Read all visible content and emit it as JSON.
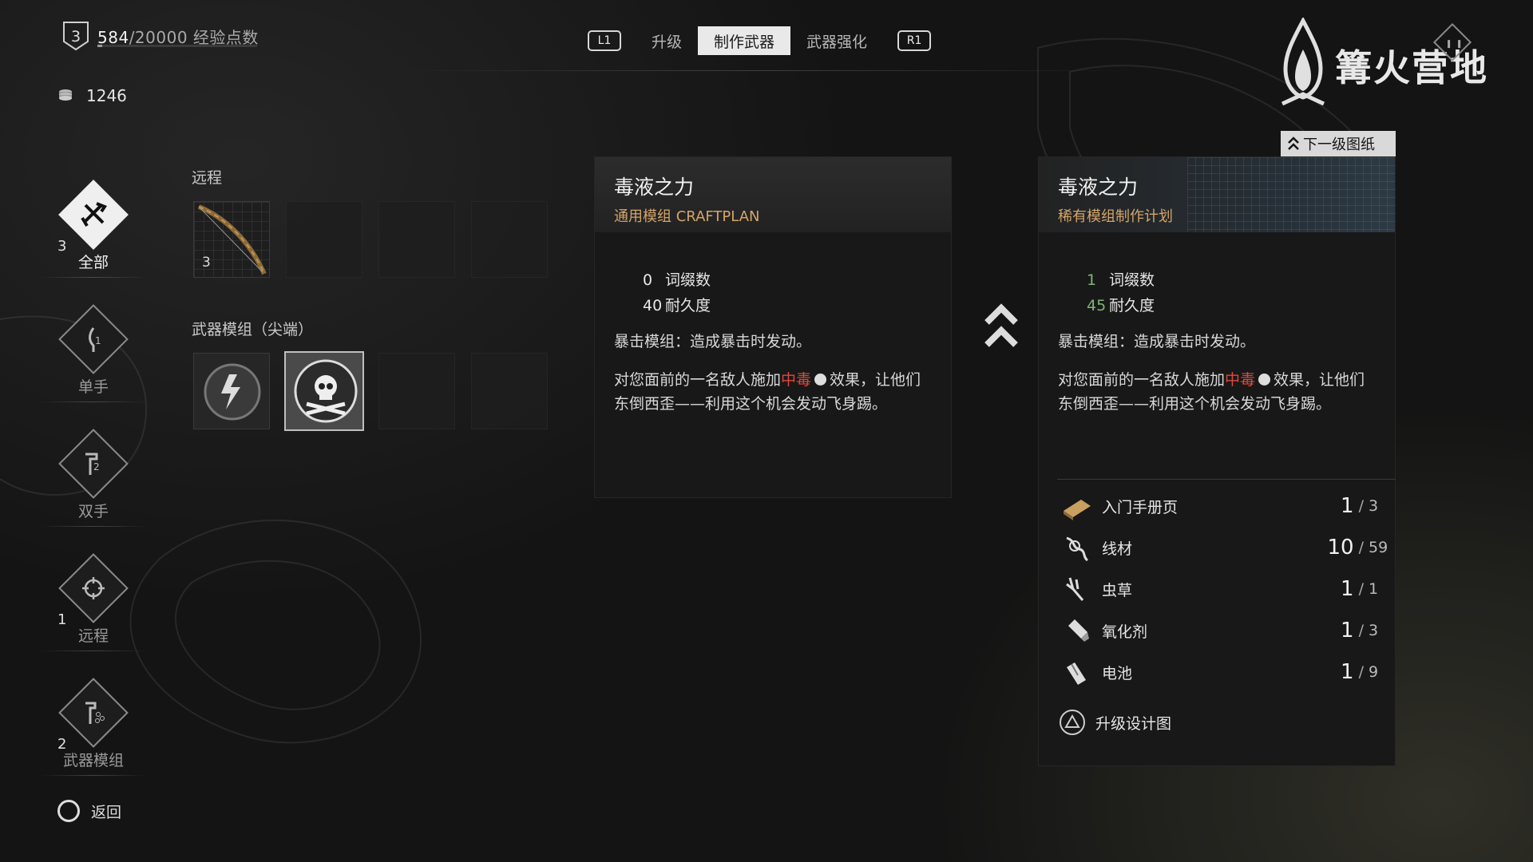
{
  "header": {
    "level": "3",
    "xp_current": "584",
    "xp_max": "/20000",
    "xp_label": "经验点数",
    "xp_progress": 0.029,
    "coins": "1246"
  },
  "tabs": {
    "left_hint": "L1",
    "right_hint": "R1",
    "items": [
      {
        "label": "升级",
        "active": false
      },
      {
        "label": "制作武器",
        "active": true
      },
      {
        "label": "武器强化",
        "active": false
      }
    ]
  },
  "logo": {
    "text": "篝火营地"
  },
  "sidebar": {
    "items": [
      {
        "label": "全部",
        "count": "3",
        "icon": "all-weapons-icon",
        "active": true
      },
      {
        "label": "单手",
        "count": "",
        "icon": "one-handed-icon",
        "active": false
      },
      {
        "label": "双手",
        "count": "",
        "icon": "two-handed-icon",
        "active": false
      },
      {
        "label": "远程",
        "count": "1",
        "icon": "crosshair-icon",
        "active": false
      },
      {
        "label": "武器模组",
        "count": "2",
        "icon": "weapon-mod-icon",
        "active": false
      }
    ],
    "back_label": "返回"
  },
  "inventory": {
    "ranged_title": "远程",
    "ranged_slot_count": "3",
    "mods_title": "武器模组（尖端）"
  },
  "card_current": {
    "title": "毒液之力",
    "subtitle": "通用模组 CRAFTPLAN",
    "affix_value": "0",
    "affix_label": "词缀数",
    "durability_value": "40",
    "durability_label": "耐久度",
    "desc1": "暴击模组：造成暴击时发动。",
    "desc2_a": "对您面前的一名敌人施加",
    "desc2_red": "中毒",
    "desc2_b": "效果，让他们东倒西歪——利用这个机会发动飞身踢。"
  },
  "card_next": {
    "tag": "下一级图纸",
    "title": "毒液之力",
    "subtitle": "稀有模组制作计划",
    "affix_value": "1",
    "affix_label": "词缀数",
    "durability_value": "45",
    "durability_label": "耐久度",
    "desc1": "暴击模组：造成暴击时发动。",
    "desc2_a": "对您面前的一名敌人施加",
    "desc2_red": "中毒",
    "desc2_b": "效果，让他们东倒西歪——利用这个机会发动飞身踢。",
    "materials": [
      {
        "name": "入门手册页",
        "have": "1",
        "need": "3",
        "icon": "manual-page-icon"
      },
      {
        "name": "线材",
        "have": "10",
        "need": "59",
        "icon": "wire-icon"
      },
      {
        "name": "虫草",
        "have": "1",
        "need": "1",
        "icon": "herb-icon"
      },
      {
        "name": "氧化剂",
        "have": "1",
        "need": "3",
        "icon": "oxidizer-icon"
      },
      {
        "name": "电池",
        "have": "1",
        "need": "9",
        "icon": "battery-icon"
      }
    ],
    "upgrade_label": "升级设计图"
  },
  "colors": {
    "accent_orange": "#d4a56a",
    "poison_red": "#e0483c",
    "stat_green": "#7fb573"
  }
}
